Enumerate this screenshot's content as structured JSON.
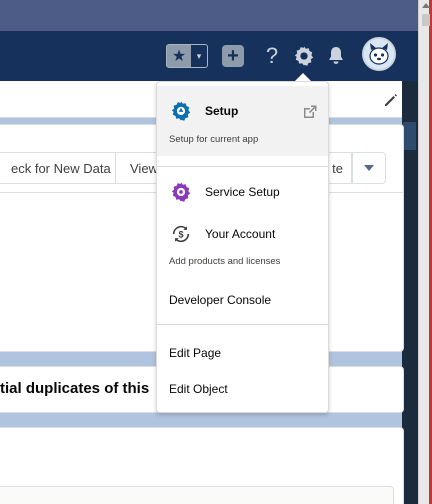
{
  "header": {
    "favorites_icon": "star-icon",
    "favorites_menu_icon": "chevron-down-icon",
    "add_icon": "plus-icon",
    "help_icon": "question-icon",
    "setup_icon": "gear-icon",
    "notifications_icon": "bell-icon",
    "avatar_icon": "user-avatar",
    "star_glyph": "★",
    "caret_glyph": "▾",
    "plus_glyph": "+",
    "help_glyph": "?"
  },
  "page": {
    "buttons": [
      "eck for New Data",
      "View",
      "te"
    ],
    "duplicates_text": "tial duplicates of this"
  },
  "setup_menu": {
    "setup": {
      "label": "Setup",
      "sublabel": "Setup for current app",
      "icon": "gear-icon",
      "open_icon": "external-link-icon"
    },
    "service_setup": {
      "label": "Service Setup",
      "icon": "gear-icon"
    },
    "your_account": {
      "label": "Your Account",
      "sublabel": "Add products and licenses",
      "icon": "dollar-refresh-icon"
    },
    "developer_console": {
      "label": "Developer Console"
    },
    "edit_page": {
      "label": "Edit Page"
    },
    "edit_object": {
      "label": "Edit Object"
    }
  },
  "colors": {
    "header_bg": "#16325c",
    "setup_icon_blue": "#0b6fb0",
    "service_setup_purple": "#8a3ab9",
    "menu_highlight": "#f3f2f2"
  }
}
